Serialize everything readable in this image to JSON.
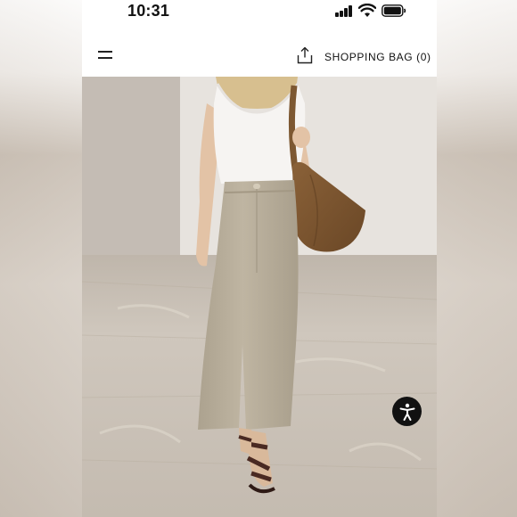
{
  "status_bar": {
    "time": "10:31",
    "icons": [
      "signal-icon",
      "wifi-icon",
      "battery-icon"
    ]
  },
  "header": {
    "menu_icon": "menu-icon",
    "share_icon": "share-icon",
    "shopping_bag_label": "SHOPPING BAG (0)"
  },
  "product": {
    "image": "model wearing white tank top, beige wide-leg cropped trousers, brown suede shoulder bag and dark strappy sandals"
  },
  "accessibility": {
    "icon": "accessibility-icon"
  },
  "colors": {
    "background": "#ffffff",
    "text": "#111111",
    "trousers": "#b8ad98",
    "bag": "#7a5530",
    "wall": "#e6e2dd",
    "floor": "#c9c0b5"
  }
}
